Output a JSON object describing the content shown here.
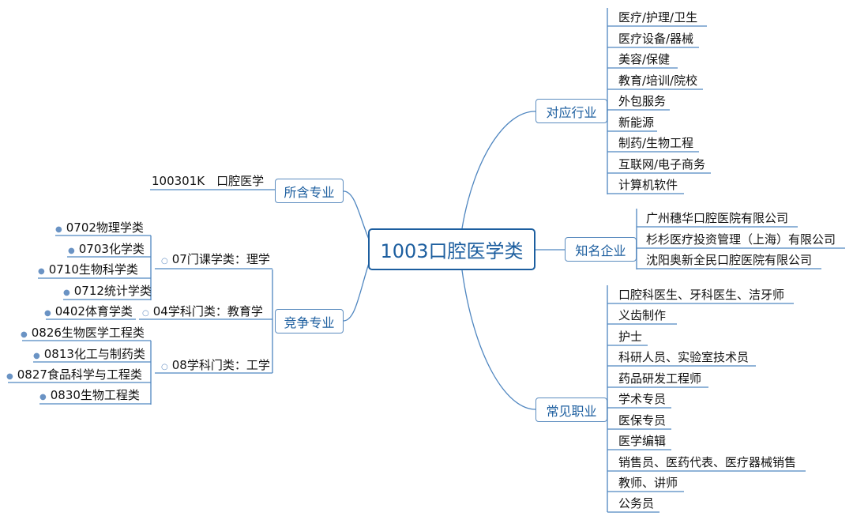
{
  "center": "1003口腔医学类",
  "branches": {
    "industries": {
      "label": "对应行业",
      "items": [
        "医疗/护理/卫生",
        "医疗设备/器械",
        "美容/保健",
        "教育/培训/院校",
        "外包服务",
        "新能源",
        "制药/生物工程",
        "互联网/电子商务",
        "计算机软件"
      ]
    },
    "companies": {
      "label": "知名企业",
      "items": [
        "广州穗华口腔医院有限公司",
        "杉杉医疗投资管理（上海）有限公司",
        "沈阳奥新全民口腔医院有限公司"
      ]
    },
    "jobs": {
      "label": "常见职业",
      "items": [
        "口腔科医生、牙科医生、洁牙师",
        "义齿制作",
        "护士",
        "科研人员、实验室技术员",
        "药品研发工程师",
        "学术专员",
        "医保专员",
        "医学编辑",
        "销售员、医药代表、医疗器械销售",
        "教师、讲师",
        "公务员"
      ]
    },
    "included": {
      "label": "所含专业",
      "items": [
        "100301K　口腔医学"
      ]
    },
    "competing": {
      "label": "竞争专业",
      "groups": [
        {
          "label": "07门课学类：理学",
          "items": [
            "0702物理学类",
            "0703化学类",
            "0710生物科学类",
            "0712统计学类"
          ]
        },
        {
          "label": "04学科门类：教育学",
          "items": [
            "0402体育学类"
          ]
        },
        {
          "label": "08学科门类：工学",
          "items": [
            "0826生物医学工程类",
            "0813化工与制药类",
            "0827食品科学与工程类",
            "0830生物工程类"
          ]
        }
      ]
    }
  }
}
